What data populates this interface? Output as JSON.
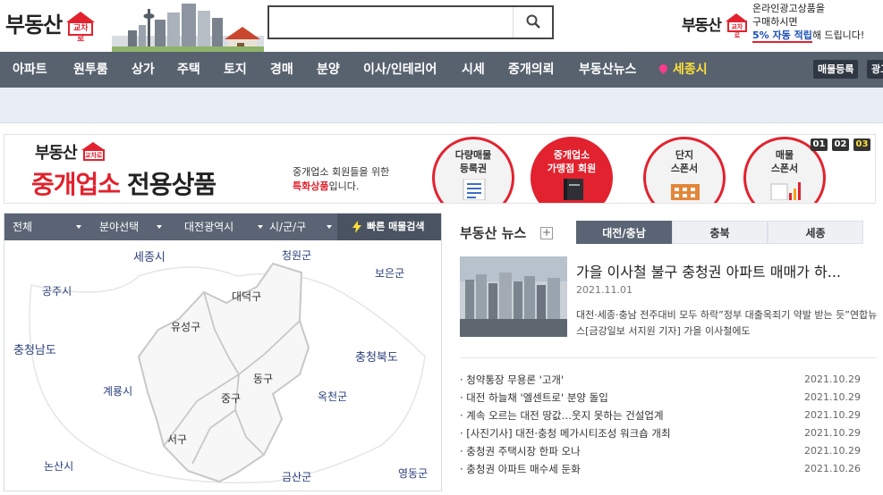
{
  "header": {
    "logo_text": "부동산",
    "logo_badge": "교차로",
    "search": {
      "placeholder": "",
      "value": ""
    },
    "promo": {
      "logo_text": "부동산",
      "logo_badge": "교차로",
      "line1": "온라인광고상품을",
      "line2": "구매하시면",
      "highlight": "5% 자동 적립",
      "line3_suffix": "해 드립니다!"
    }
  },
  "nav": {
    "items": [
      "아파트",
      "원투룸",
      "상가",
      "주택",
      "토지",
      "경매",
      "분양",
      "이사/인테리어",
      "시세",
      "중개의뢰",
      "부동산뉴스"
    ],
    "region": "세종시",
    "btn_listing": "매물등록",
    "btn_ad": "광고"
  },
  "banner": {
    "logo_text": "부동산",
    "logo_badge": "교차로",
    "title_red": "중개업소",
    "title_dark": "전용상품",
    "desc_line1": "중개업소 회원들을 위한",
    "desc_red": "특화상품",
    "desc_suffix": "입니다.",
    "circles": [
      {
        "line1": "다량매물",
        "line2": "등록권"
      },
      {
        "line1": "중개업소",
        "line2": "가맹점 회원"
      },
      {
        "line1": "단지",
        "line2": "스폰서"
      },
      {
        "line1": "매물",
        "line2": "스폰서"
      }
    ],
    "pager": [
      "01",
      "02",
      "03"
    ],
    "active_index": 1,
    "active_pager": 2
  },
  "map": {
    "filters": [
      "전체",
      "분야선택",
      "대전광역시",
      "시/군/구"
    ],
    "quick_search": "빠른 매물검색",
    "regions_outer": [
      "세종시",
      "청원군",
      "공주시",
      "보은군",
      "충청남도",
      "충청북도",
      "계룡시",
      "옥천군",
      "논산시",
      "금산군",
      "영동군"
    ],
    "regions_inner": [
      "대덕구",
      "유성구",
      "동구",
      "중구",
      "서구"
    ]
  },
  "news": {
    "title": "부동산 뉴스",
    "plus": "+",
    "tabs": [
      "대전/충남",
      "충북",
      "세종"
    ],
    "featured": {
      "title": "가을 이사철 불구 충청권 아파트 매매가 하...",
      "date": "2021.11.01",
      "desc": "대전·세종·충남 전주대비 모두 하락”정부 대출옥죄기 약발 받는 듯”연합뉴스[금강일보 서지원 기자] 가을 이사철에도"
    },
    "items": [
      {
        "title": "· 청약통장 무용론 '고개'",
        "date": "2021.10.29"
      },
      {
        "title": "· 대전 하늘채 '엘센트로' 분양 돌입",
        "date": "2021.10.29"
      },
      {
        "title": "· 계속 오르는 대전 땅값…웃지 못하는 건설업계",
        "date": "2021.10.29"
      },
      {
        "title": "· [사진기사] 대전·충청 메가시티조성 워크숍 개최",
        "date": "2021.10.29"
      },
      {
        "title": "· 충청권 주택시장 한파 오나",
        "date": "2021.10.29"
      },
      {
        "title": "· 충청권 아파트 매수세 둔화",
        "date": "2021.10.26"
      }
    ]
  },
  "colors": {
    "nav_bg": "#58626f",
    "accent_red": "#e2222e",
    "region_yellow": "#ffe13a"
  }
}
